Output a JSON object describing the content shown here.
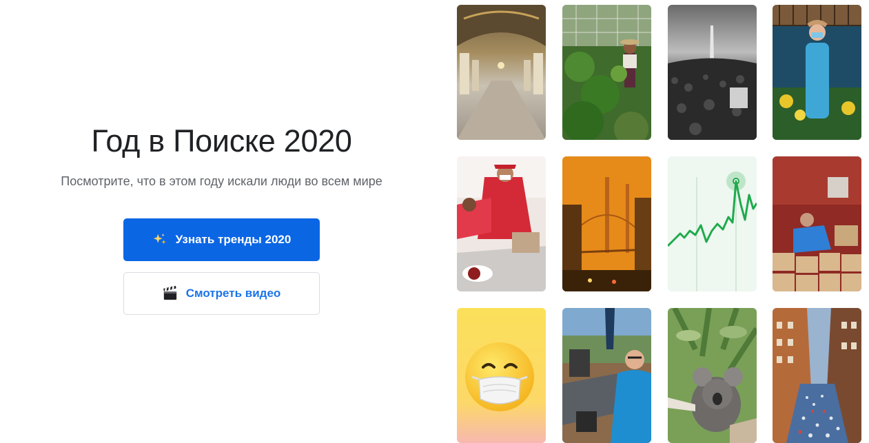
{
  "hero": {
    "title": "Год в Поиске 2020",
    "subtitle": "Посмотрите, что в этом году искали люди во всем мире",
    "primary_button": {
      "label": "Узнать тренды 2020",
      "icon": "sparkles-icon"
    },
    "secondary_button": {
      "label": "Смотреть видео",
      "icon": "clapperboard-icon"
    }
  },
  "colors": {
    "primary": "#0b66e4",
    "link": "#1a73e8",
    "title": "#202124",
    "subtitle": "#5f6368"
  },
  "gallery": {
    "tiles": [
      {
        "name": "hall-of-mirrors-photo"
      },
      {
        "name": "garden-harvest-photo"
      },
      {
        "name": "washington-protest-photo"
      },
      {
        "name": "masked-health-worker-photo"
      },
      {
        "name": "food-distribution-photo"
      },
      {
        "name": "orange-sky-bridge-photo"
      },
      {
        "name": "trend-line-chart"
      },
      {
        "name": "volunteer-packing-boxes-photo"
      },
      {
        "name": "masked-emoji-tile"
      },
      {
        "name": "patio-video-call-photo"
      },
      {
        "name": "koala-rescue-photo"
      },
      {
        "name": "city-street-crowd-photo"
      }
    ]
  }
}
